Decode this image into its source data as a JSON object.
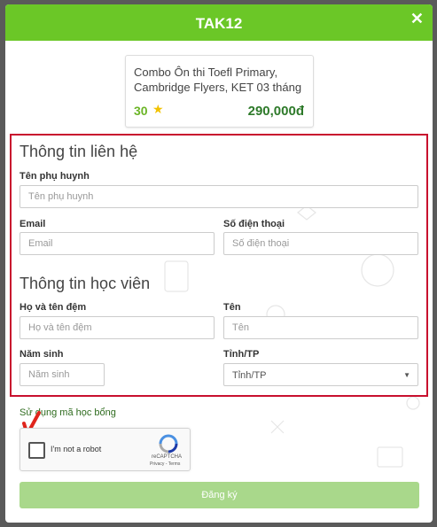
{
  "header": {
    "title": "TAK12",
    "close_icon": "close-icon"
  },
  "product": {
    "name": "Combo Ôn thi Toefl Primary, Cambridge Flyers, KET 03 tháng",
    "lessons": "30",
    "price": "290,000đ",
    "star_icon": "star-icon"
  },
  "contact": {
    "title": "Thông tin liên hệ",
    "parent_name": {
      "label": "Tên phụ huynh",
      "placeholder": "Tên phụ huynh",
      "value": ""
    },
    "email": {
      "label": "Email",
      "placeholder": "Email",
      "value": ""
    },
    "phone": {
      "label": "Số điện thoại",
      "placeholder": "Số điện thoại",
      "value": ""
    }
  },
  "student": {
    "title": "Thông tin học viên",
    "middle_name": {
      "label": "Họ và tên đệm",
      "placeholder": "Họ và tên đệm",
      "value": ""
    },
    "first_name": {
      "label": "Tên",
      "placeholder": "Tên",
      "value": ""
    },
    "birth_year": {
      "label": "Năm sinh",
      "placeholder": "Năm sinh",
      "value": ""
    },
    "province": {
      "label": "Tỉnh/TP",
      "selected": "Tỉnh/TP"
    }
  },
  "promo_link": "Sử dụng mã học bổng",
  "recaptcha": {
    "label": "I'm not a robot",
    "brand": "reCAPTCHA",
    "links": "Privacy - Terms",
    "checked": false
  },
  "submit_label": "Đăng ký",
  "colors": {
    "header": "#6bc727",
    "highlight_border": "#c8102e",
    "submit": "#a9d88b",
    "price": "#2e7a2a",
    "annotation_arrow": "#e0251c"
  }
}
